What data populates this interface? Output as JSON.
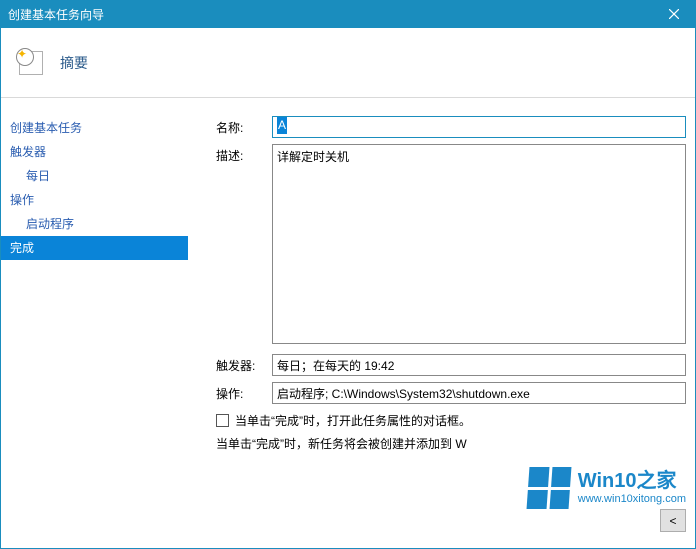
{
  "window": {
    "title": "创建基本任务向导"
  },
  "header": {
    "title": "摘要"
  },
  "sidebar": {
    "items": [
      {
        "label": "创建基本任务",
        "indent": false,
        "selected": false
      },
      {
        "label": "触发器",
        "indent": false,
        "selected": false
      },
      {
        "label": "每日",
        "indent": true,
        "selected": false
      },
      {
        "label": "操作",
        "indent": false,
        "selected": false
      },
      {
        "label": "启动程序",
        "indent": true,
        "selected": false
      },
      {
        "label": "完成",
        "indent": false,
        "selected": true
      }
    ]
  },
  "form": {
    "name_label": "名称:",
    "name_value": "A",
    "desc_label": "描述:",
    "desc_value": "详解定时关机",
    "trigger_label": "触发器:",
    "trigger_value": "每日；在每天的 19:42",
    "action_label": "操作:",
    "action_value": "启动程序; C:\\Windows\\System32\\shutdown.exe",
    "checkbox_label": "当单击“完成”时，打开此任务属性的对话框。",
    "info_text": "当单击“完成”时，新任务将会被创建并添加到 W"
  },
  "buttons": {
    "back": "<"
  },
  "watermark": {
    "title": "Win10之家",
    "sub": "www.win10xitong.com"
  }
}
